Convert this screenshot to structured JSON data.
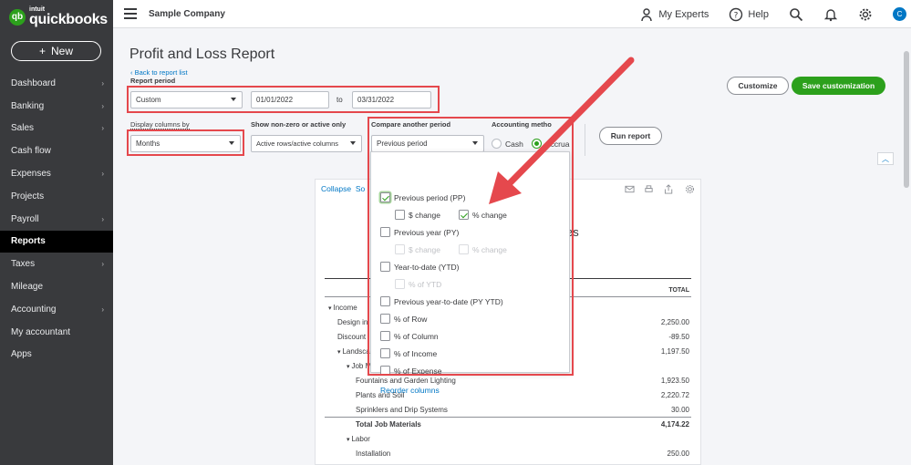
{
  "app": {
    "logo_small": "intuit",
    "logo_text": "quickbooks",
    "new_button": "New"
  },
  "sidebar": {
    "items": [
      {
        "label": "Dashboard",
        "chevron": true
      },
      {
        "label": "Banking",
        "chevron": true
      },
      {
        "label": "Sales",
        "chevron": true
      },
      {
        "label": "Cash flow",
        "chevron": false
      },
      {
        "label": "Expenses",
        "chevron": true
      },
      {
        "label": "Projects",
        "chevron": false
      },
      {
        "label": "Payroll",
        "chevron": true
      },
      {
        "label": "Reports",
        "chevron": false,
        "active": true
      },
      {
        "label": "Taxes",
        "chevron": true
      },
      {
        "label": "Mileage",
        "chevron": false
      },
      {
        "label": "Accounting",
        "chevron": true
      },
      {
        "label": "My accountant",
        "chevron": false
      },
      {
        "label": "Apps",
        "chevron": false
      }
    ]
  },
  "topbar": {
    "company": "Sample Company",
    "experts": "My Experts",
    "help": "Help",
    "avatar_letter": "C"
  },
  "page": {
    "title": "Profit and Loss Report",
    "back_link": "Back to report list",
    "report_period_label": "Report period",
    "report_period_value": "Custom",
    "date_from": "01/01/2022",
    "date_to_label": "to",
    "date_to": "03/31/2022",
    "display_columns_label": "Display columns by",
    "display_columns_value": "Months",
    "show_nonzero_label": "Show non-zero or active only",
    "show_nonzero_value": "Active rows/active columns",
    "compare_label": "Compare another period",
    "compare_value": "Previous period",
    "accounting_method_label": "Accounting metho",
    "cash_label": "Cash",
    "accrual_label": "Accrua",
    "run_report": "Run report",
    "customize": "Customize",
    "save_customization": "Save customization"
  },
  "dropdown": {
    "options": [
      {
        "label": "Previous period (PP)",
        "checked": true,
        "dim": false
      },
      {
        "label": "$ change",
        "checked": false,
        "dim": false
      },
      {
        "label": "% change",
        "checked": true,
        "dim": false
      },
      {
        "label": "Previous year (PY)",
        "checked": false,
        "dim": false
      },
      {
        "label": "$ change",
        "checked": false,
        "dim": true
      },
      {
        "label": "% change",
        "checked": false,
        "dim": true
      },
      {
        "label": "Year-to-date (YTD)",
        "checked": false,
        "dim": false
      },
      {
        "label": "% of YTD",
        "checked": false,
        "dim": true
      },
      {
        "label": "Previous year-to-date (PY YTD)",
        "checked": false,
        "dim": false
      },
      {
        "label": "% of Row",
        "checked": false,
        "dim": false
      },
      {
        "label": "% of Column",
        "checked": false,
        "dim": false
      },
      {
        "label": "% of Income",
        "checked": false,
        "dim": false
      },
      {
        "label": "% of Expense",
        "checked": false,
        "dim": false
      }
    ],
    "reorder": "Reorder columns"
  },
  "report": {
    "collapse": "Collapse",
    "sort_partial": "So",
    "title_partial": "g Services",
    "total_header": "TOTAL",
    "rows": [
      {
        "label": "Income",
        "amount": "",
        "indent": 0,
        "toggle": true
      },
      {
        "label": "Design in",
        "amount": "2,250.00",
        "indent": 1,
        "toggle": false
      },
      {
        "label": "Discount",
        "amount": "-89.50",
        "indent": 1,
        "toggle": false
      },
      {
        "label": "Landscap",
        "amount": "1,197.50",
        "indent": 1,
        "toggle": true
      },
      {
        "label": "Job Ma",
        "amount": "",
        "indent": 2,
        "toggle": true
      },
      {
        "label": "Fountains and Garden Lighting",
        "amount": "1,923.50",
        "indent": 3,
        "toggle": false
      },
      {
        "label": "Plants and Soil",
        "amount": "2,220.72",
        "indent": 3,
        "toggle": false
      },
      {
        "label": "Sprinklers and Drip Systems",
        "amount": "30.00",
        "indent": 3,
        "toggle": false
      },
      {
        "label": "Total Job Materials",
        "amount": "4,174.22",
        "indent": 3,
        "toggle": false,
        "bold": true
      },
      {
        "label": "Labor",
        "amount": "",
        "indent": 2,
        "toggle": true
      },
      {
        "label": "Installation",
        "amount": "250.00",
        "indent": 3,
        "toggle": false
      }
    ]
  },
  "colors": {
    "accent_green": "#2ca01c",
    "highlight_red": "#e5484d",
    "link_blue": "#0077c5",
    "sidebar": "#393a3d"
  }
}
